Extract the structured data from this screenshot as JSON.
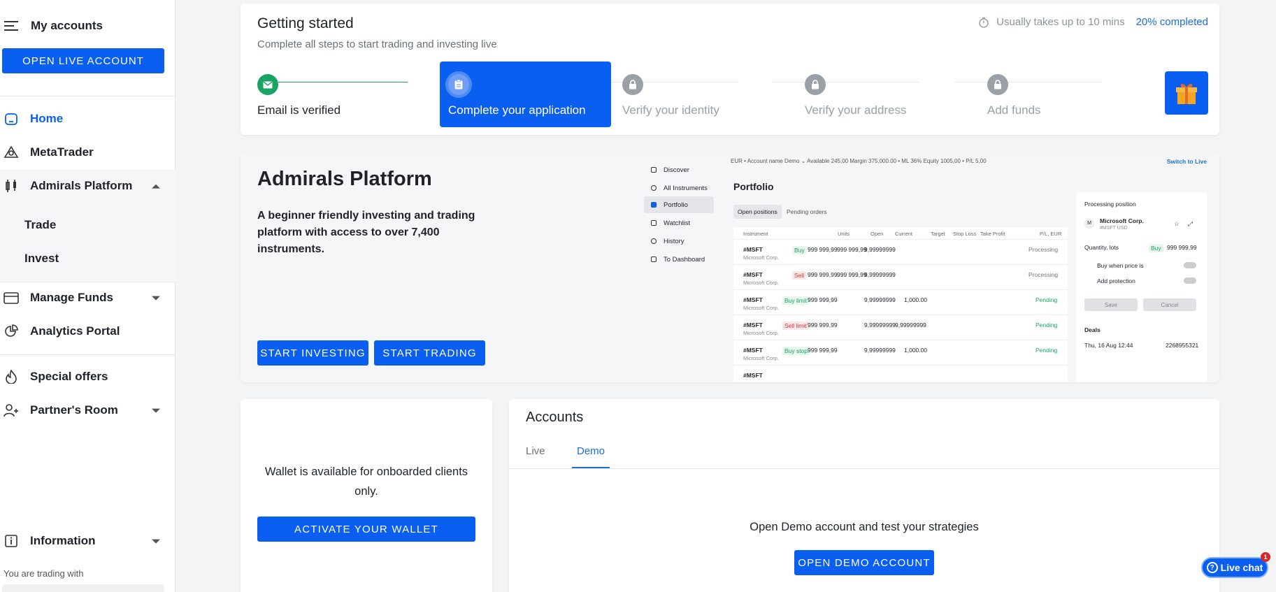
{
  "sidebar": {
    "title": "My accounts",
    "open_live_label": "OPEN LIVE ACCOUNT",
    "items": {
      "home": "Home",
      "metatrader": "MetaTrader",
      "admirals_platform": "Admirals Platform",
      "trade": "Trade",
      "invest": "Invest",
      "manage_funds": "Manage Funds",
      "analytics_portal": "Analytics Portal",
      "special_offers": "Special offers",
      "partners_room": "Partner's Room",
      "information": "Information"
    },
    "trading_with": "You are trading with"
  },
  "getting_started": {
    "title": "Getting started",
    "subtitle": "Complete all steps to start trading and investing live",
    "eta": "Usually takes up to 10 mins",
    "progress_label": "20% completed",
    "progress": 0.2,
    "steps": [
      {
        "label": "Email is verified",
        "state": "done"
      },
      {
        "label": "Complete your application",
        "state": "current"
      },
      {
        "label": "Verify your identity",
        "state": "locked"
      },
      {
        "label": "Verify your address",
        "state": "locked"
      },
      {
        "label": "Add funds",
        "state": "locked"
      }
    ]
  },
  "admirals_platform": {
    "title": "Admirals Platform",
    "description": "A beginner friendly investing and trading platform with access to over 7,400 instruments.",
    "start_investing": "START INVESTING",
    "start_trading": "START TRADING",
    "preview": {
      "nav": [
        "Discover",
        "All Instruments",
        "Portfolio",
        "Watchlist",
        "History",
        "To Dashboard"
      ],
      "topbar": "EUR • Account name  Demo  ⌄    Available 245,00    Margin 375,000.00 • ML 36%    Equity 1005,00 • P/L 5,00",
      "switch_live": "Switch to Live",
      "portfolio_title": "Portfolio",
      "tabs": [
        "Open positions",
        "Pending orders"
      ],
      "headers": [
        "Instrument",
        "Units",
        "Open",
        "Current",
        "Target",
        "Stop Loss",
        "Take Profit",
        "P/L, EUR"
      ],
      "rows": [
        {
          "symbol": "#MSFT",
          "name": "Microsoft Corp.",
          "side": "Buy",
          "units": "999 999,99",
          "open": "999 999,99",
          "current": "9,99999999",
          "target": "",
          "status": "Processing"
        },
        {
          "symbol": "#MSFT",
          "name": "Microsoft Corp.",
          "side": "Sell",
          "units": "999 999,99",
          "open": "999 999,99",
          "current": "9,99999999",
          "target": "",
          "status": "Processing"
        },
        {
          "symbol": "#MSFT",
          "name": "Microsoft Corp.",
          "side": "Buy limit",
          "units": "999 999,99",
          "open": "",
          "current": "9,99999999",
          "target": "1,000.00",
          "status": "Pending"
        },
        {
          "symbol": "#MSFT",
          "name": "Microsoft Corp.",
          "side": "Sell limit",
          "units": "999 999,99",
          "open": "",
          "current": "9,99999999",
          "target": "9,99999999",
          "status": "Pending"
        },
        {
          "symbol": "#MSFT",
          "name": "Microsoft Corp.",
          "side": "Buy stop",
          "units": "999 999,99",
          "open": "",
          "current": "9,99999999",
          "target": "1,000.00",
          "status": "Pending"
        },
        {
          "symbol": "#MSFT",
          "name": "",
          "side": "",
          "units": "",
          "open": "",
          "current": "",
          "target": "",
          "status": ""
        }
      ],
      "panel": {
        "title": "Processing position",
        "company": "Microsoft Corp.",
        "ticker": "#MSFT  USD",
        "quantity_label": "Quantity, lots",
        "quantity_side": "Buy",
        "quantity_value": "999 999,99",
        "buy_when": "Buy when price is",
        "protection": "Add protection",
        "save": "Save",
        "cancel": "Cancel",
        "deals": "Deals",
        "deal_date": "Thu, 16 Aug 12:44",
        "deal_id": "2268955321"
      }
    }
  },
  "wallet": {
    "text": "Wallet is available for onboarded clients only.",
    "button": "ACTIVATE YOUR WALLET"
  },
  "accounts": {
    "title": "Accounts",
    "tabs": [
      "Live",
      "Demo"
    ],
    "active_tab": "Demo",
    "message": "Open Demo account and test your strategies",
    "button": "OPEN DEMO ACCOUNT"
  },
  "live_chat": {
    "label": "Live chat",
    "badge": "1"
  }
}
